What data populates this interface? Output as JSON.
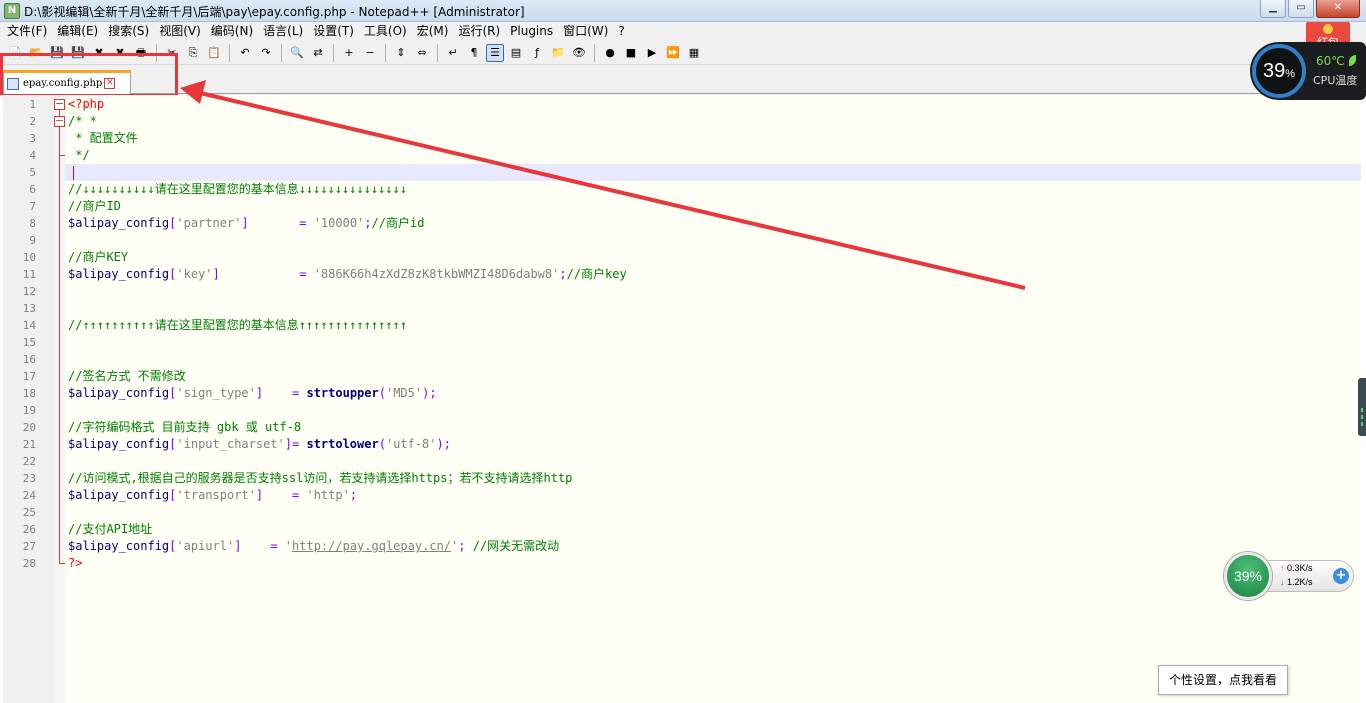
{
  "window": {
    "title": "D:\\影视编辑\\全新千月\\全新千月\\后端\\pay\\epay.config.php - Notepad++ [Administrator]",
    "app_icon": "notepad-plus-plus-icon",
    "controls": {
      "minimize": "▁",
      "maximize": "▭",
      "close": "✕"
    }
  },
  "menu": [
    "文件(F)",
    "编辑(E)",
    "搜索(S)",
    "视图(V)",
    "编码(N)",
    "语言(L)",
    "设置(T)",
    "工具(O)",
    "宏(M)",
    "运行(R)",
    "Plugins",
    "窗口(W)",
    "?"
  ],
  "toolbar": {
    "buttons": [
      {
        "name": "new-file-icon",
        "glyph": "📄"
      },
      {
        "name": "open-file-icon",
        "glyph": "📂"
      },
      {
        "name": "save-icon",
        "glyph": "💾"
      },
      {
        "name": "save-all-icon",
        "glyph": "💾"
      },
      {
        "name": "close-file-icon",
        "glyph": "✖"
      },
      {
        "name": "close-all-icon",
        "glyph": "✖"
      },
      {
        "name": "print-icon",
        "glyph": "🖶"
      },
      {
        "name": "cut-icon",
        "glyph": "✂"
      },
      {
        "name": "copy-icon",
        "glyph": "⎘"
      },
      {
        "name": "paste-icon",
        "glyph": "📋"
      },
      {
        "name": "undo-icon",
        "glyph": "↶"
      },
      {
        "name": "redo-icon",
        "glyph": "↷"
      },
      {
        "name": "find-icon",
        "glyph": "🔍"
      },
      {
        "name": "replace-icon",
        "glyph": "⇄"
      },
      {
        "name": "zoom-in-icon",
        "glyph": "+"
      },
      {
        "name": "zoom-out-icon",
        "glyph": "−"
      },
      {
        "name": "sync-vertical-icon",
        "glyph": "⇕"
      },
      {
        "name": "sync-horizontal-icon",
        "glyph": "⇔"
      },
      {
        "name": "word-wrap-icon",
        "glyph": "↵"
      },
      {
        "name": "show-all-chars-icon",
        "glyph": "¶"
      },
      {
        "name": "indent-guide-icon",
        "glyph": "☰",
        "active": true
      },
      {
        "name": "doc-map-icon",
        "glyph": "▤"
      },
      {
        "name": "function-list-icon",
        "glyph": "ƒ"
      },
      {
        "name": "folder-workspace-icon",
        "glyph": "📁"
      },
      {
        "name": "monitor-icon",
        "glyph": "👁"
      },
      {
        "name": "record-macro-icon",
        "glyph": "●"
      },
      {
        "name": "stop-macro-icon",
        "glyph": "■"
      },
      {
        "name": "play-macro-icon",
        "glyph": "▶"
      },
      {
        "name": "run-macro-multiple-icon",
        "glyph": "⏩"
      },
      {
        "name": "save-macro-icon",
        "glyph": "▦"
      }
    ]
  },
  "tab": {
    "label": "epay.config.php",
    "close": "✕"
  },
  "editor": {
    "current_line": 5,
    "lines": [
      [
        [
          "<?php",
          "php"
        ]
      ],
      [
        [
          "/* *",
          "comment"
        ]
      ],
      [
        [
          " * 配置文件",
          "comment"
        ]
      ],
      [
        [
          " */",
          "comment"
        ]
      ],
      [],
      [
        [
          "//↓↓↓↓↓↓↓↓↓↓请在这里配置您的基本信息↓↓↓↓↓↓↓↓↓↓↓↓↓↓↓",
          "comment"
        ]
      ],
      [
        [
          "//商户ID",
          "comment"
        ]
      ],
      [
        [
          "$alipay_config",
          "var"
        ],
        [
          "[",
          "op"
        ],
        [
          "'partner'",
          "str"
        ],
        [
          "]",
          "op"
        ],
        [
          "       ",
          "plain"
        ],
        [
          "=",
          "op"
        ],
        [
          " ",
          "plain"
        ],
        [
          "'10000'",
          "str"
        ],
        [
          ";",
          "op"
        ],
        [
          "//商户id",
          "comment"
        ]
      ],
      [],
      [
        [
          "//商户KEY",
          "comment"
        ]
      ],
      [
        [
          "$alipay_config",
          "var"
        ],
        [
          "[",
          "op"
        ],
        [
          "'key'",
          "str"
        ],
        [
          "]",
          "op"
        ],
        [
          "           ",
          "plain"
        ],
        [
          "=",
          "op"
        ],
        [
          " ",
          "plain"
        ],
        [
          "'886K66h4zXdZ8zK8tkbWMZI48D6dabw8'",
          "str"
        ],
        [
          ";",
          "op"
        ],
        [
          "//商户key",
          "comment"
        ]
      ],
      [],
      [],
      [
        [
          "//↑↑↑↑↑↑↑↑↑↑请在这里配置您的基本信息↑↑↑↑↑↑↑↑↑↑↑↑↑↑↑",
          "comment"
        ]
      ],
      [],
      [],
      [
        [
          "//签名方式 不需修改",
          "comment"
        ]
      ],
      [
        [
          "$alipay_config",
          "var"
        ],
        [
          "[",
          "op"
        ],
        [
          "'sign_type'",
          "str"
        ],
        [
          "]",
          "op"
        ],
        [
          "    ",
          "plain"
        ],
        [
          "=",
          "op"
        ],
        [
          " ",
          "plain"
        ],
        [
          "strtoupper",
          "func"
        ],
        [
          "(",
          "op"
        ],
        [
          "'MD5'",
          "str"
        ],
        [
          ");",
          "op"
        ]
      ],
      [],
      [
        [
          "//字符编码格式 目前支持 gbk 或 utf-8",
          "comment"
        ]
      ],
      [
        [
          "$alipay_config",
          "var"
        ],
        [
          "[",
          "op"
        ],
        [
          "'input_charset'",
          "str"
        ],
        [
          "]=",
          "op"
        ],
        [
          " ",
          "plain"
        ],
        [
          "strtolower",
          "func"
        ],
        [
          "(",
          "op"
        ],
        [
          "'utf-8'",
          "str"
        ],
        [
          ");",
          "op"
        ]
      ],
      [],
      [
        [
          "//访问模式,根据自己的服务器是否支持ssl访问，若支持请选择https；若不支持请选择http",
          "comment"
        ]
      ],
      [
        [
          "$alipay_config",
          "var"
        ],
        [
          "[",
          "op"
        ],
        [
          "'transport'",
          "str"
        ],
        [
          "]",
          "op"
        ],
        [
          "    ",
          "plain"
        ],
        [
          "=",
          "op"
        ],
        [
          " ",
          "plain"
        ],
        [
          "'http'",
          "str"
        ],
        [
          ";",
          "op"
        ]
      ],
      [],
      [
        [
          "//支付API地址",
          "comment"
        ]
      ],
      [
        [
          "$alipay_config",
          "var"
        ],
        [
          "[",
          "op"
        ],
        [
          "'apiurl'",
          "str"
        ],
        [
          "]",
          "op"
        ],
        [
          "    ",
          "plain"
        ],
        [
          "=",
          "op"
        ],
        [
          " ",
          "plain"
        ],
        [
          "'",
          "str"
        ],
        [
          "http://pay.gqlepay.cn/",
          "url"
        ],
        [
          "'",
          "str"
        ],
        [
          ";",
          "op"
        ],
        [
          " ",
          "plain"
        ],
        [
          "//网关无需改动",
          "comment"
        ]
      ],
      [
        [
          "?>",
          "php"
        ]
      ]
    ]
  },
  "overlays": {
    "hongbao_label": "红包",
    "cpu_percent": "39",
    "cpu_percent_unit": "%",
    "cpu_temp": "60℃",
    "cpu_label": "CPU温度",
    "net_percent": "39%",
    "net_up": "0.3K/s",
    "net_down": "1.2K/s",
    "tooltip": "个性设置，点我看看"
  },
  "colors": {
    "comment": "#008000",
    "php_tag": "#ff0000",
    "annotation": "#e8363a",
    "tab_accent": "#f5a623"
  }
}
